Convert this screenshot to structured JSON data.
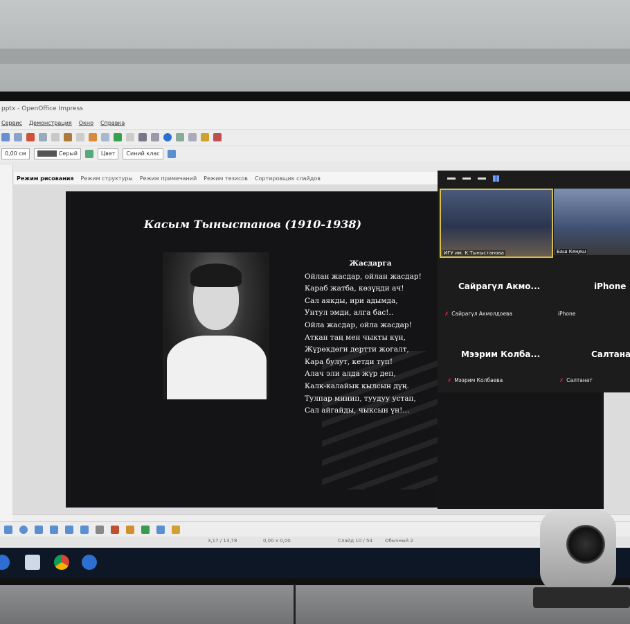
{
  "window": {
    "title": "pptx - OpenOffice Impress"
  },
  "menu": [
    "Сервис",
    "Демонстрация",
    "Окно",
    "Справка"
  ],
  "format_bar": {
    "size_value": "0,00 см",
    "line_color": "Серый",
    "area_style": "Цвет",
    "area_color": "Синий клас"
  },
  "view_tabs": [
    "Режим рисования",
    "Режим структуры",
    "Режим примечаний",
    "Режим тезисов",
    "Сортировщик слайдов"
  ],
  "slide": {
    "title": "Касым Тыныстанов (1910-1938)",
    "poem_title": "Жасдарга",
    "poem_lines": [
      "Ойлан жаcдар, ойлан жаcдар!",
      "Караб жатба, көзүңди ач!",
      "Сал аякды, ири адымда,",
      "Унтул эмди, алга бас!..",
      "Ойла жаcдар, ойла жаcдар!",
      "Аткан таң мен чыкты күн,",
      "Жүрөкдөги дертти жогалт,",
      "Кара булут, кетди туп!",
      "Алач эли алда жүр деп,",
      "Калк-калайык кылсын дүң.",
      "Тулпар минип, туудуу устап,",
      "Сал айгайды, чыксын үн!..."
    ]
  },
  "zoom": {
    "tiles": [
      {
        "label": "ИГУ им. К.Тыныстанова"
      },
      {
        "label": "Баш Кеңеш"
      }
    ],
    "participants": [
      {
        "display": "Сайрагүл Акмо...",
        "full": "Сайрагүл Акмолдоева"
      },
      {
        "display": "iPhone",
        "full": "iPhone"
      },
      {
        "display": "Мээрим Колба...",
        "full": "Мээрим Колбаева"
      },
      {
        "display": "Салтанат",
        "full": "Салтанат"
      }
    ]
  },
  "status": {
    "position": "3,17 / 13,78",
    "size": "0,00 x 0,00",
    "slide": "Слайд 10 / 54",
    "layout": "Обычный 2"
  },
  "colors": {
    "accent": "#2d6fd0",
    "mic_muted": "#e24444",
    "zoom_bg": "#1c1c1c"
  },
  "icons": [
    "bullet-icon",
    "chrome-icon",
    "zoom-icon",
    "windows-icon"
  ]
}
